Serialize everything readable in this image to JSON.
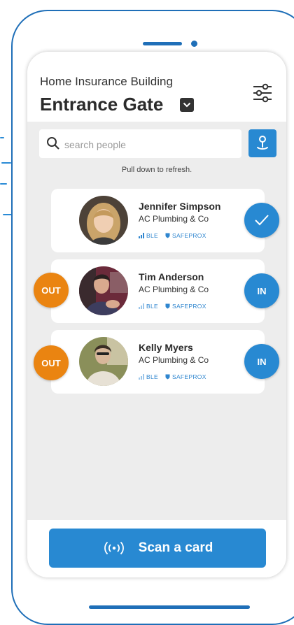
{
  "header": {
    "subtitle": "Home Insurance Building",
    "title": "Entrance Gate"
  },
  "search": {
    "placeholder": "search people"
  },
  "refresh_hint": "Pull down to refresh.",
  "people": [
    {
      "name": "Jennifer Simpson",
      "company": "AC Plumbing & Co",
      "tag_ble": "BLE",
      "tag_safeprox": "SAFEPROX",
      "status": "checked-in"
    },
    {
      "name": "Tim Anderson",
      "company": "AC Plumbing & Co",
      "tag_ble": "BLE",
      "tag_safeprox": "SAFEPROX",
      "out_label": "OUT",
      "in_label": "IN"
    },
    {
      "name": "Kelly Myers",
      "company": "AC Plumbing & Co",
      "tag_ble": "BLE",
      "tag_safeprox": "SAFEPROX",
      "out_label": "OUT",
      "in_label": "IN"
    }
  ],
  "scan_button": {
    "label": "Scan a card"
  },
  "colors": {
    "accent": "#2889d2",
    "out": "#ea8411",
    "frame": "#1f6fb8"
  }
}
